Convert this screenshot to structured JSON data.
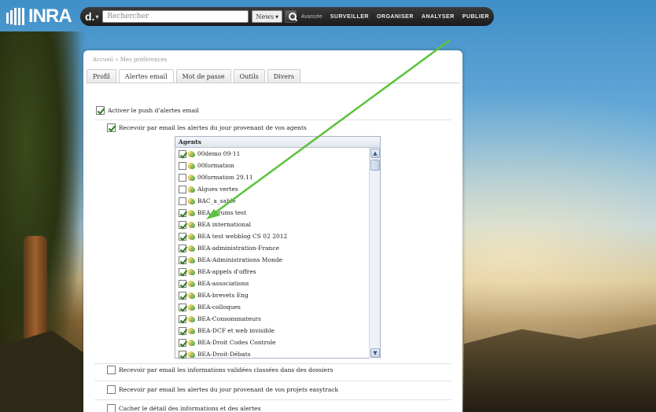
{
  "logo": {
    "text": "INRA"
  },
  "topbar": {
    "brand": "d.",
    "search_placeholder": "Rechercher",
    "news_select": "News",
    "advanced": "Avancée",
    "nav": [
      "SURVEILLER",
      "ORGANISER",
      "ANALYSER",
      "PUBLIER"
    ]
  },
  "breadcrumb": "Accueil » Mes préférences",
  "tabs": [
    "Profil",
    "Alertes email",
    "Mot de passe",
    "Outils",
    "Divers"
  ],
  "active_tab": "Alertes email",
  "options": {
    "push": {
      "label": "Activer le push d'alertes email",
      "checked": true
    },
    "agents_daily": {
      "label": "Recevoir par email les alertes du jour provenant de vos agents",
      "checked": true
    },
    "folders": {
      "label": "Recevoir par email les informations validées classées dans des dossiers",
      "checked": false
    },
    "easytrack": {
      "label": "Recevoir par email les alertes du jour provenant de vos projets easytrack",
      "checked": false
    },
    "hide_details": {
      "label": "Cacher le détail des informations et des alertes",
      "checked": false
    }
  },
  "agents": {
    "header": "Agents",
    "items": [
      {
        "name": "00demo 09-11",
        "checked": true
      },
      {
        "name": "00formation",
        "checked": false
      },
      {
        "name": "00formation 29.11",
        "checked": false
      },
      {
        "name": "Algues vertes",
        "checked": false
      },
      {
        "name": "BAC_a_sable",
        "checked": false
      },
      {
        "name": "BEA forums test",
        "checked": true
      },
      {
        "name": "BEA international",
        "checked": true
      },
      {
        "name": "BEA test webblog CS 02 2012",
        "checked": true
      },
      {
        "name": "BEA-administration-France",
        "checked": true
      },
      {
        "name": "BEA-Administrations Monde",
        "checked": true
      },
      {
        "name": "BEA-appels d'offres",
        "checked": true
      },
      {
        "name": "BEA-associations",
        "checked": true
      },
      {
        "name": "BEA-brevets Eng",
        "checked": true
      },
      {
        "name": "BEA-colloques",
        "checked": true
      },
      {
        "name": "BEA-Consommateurs",
        "checked": true
      },
      {
        "name": "BEA-DCF et web invisible",
        "checked": true
      },
      {
        "name": "BEA-Droit Codes Controle",
        "checked": true
      },
      {
        "name": "BEA-Droit-Débats",
        "checked": true
      }
    ]
  },
  "colors": {
    "accent_arrow": "#5cc23a",
    "check": "#2a7a1a"
  }
}
